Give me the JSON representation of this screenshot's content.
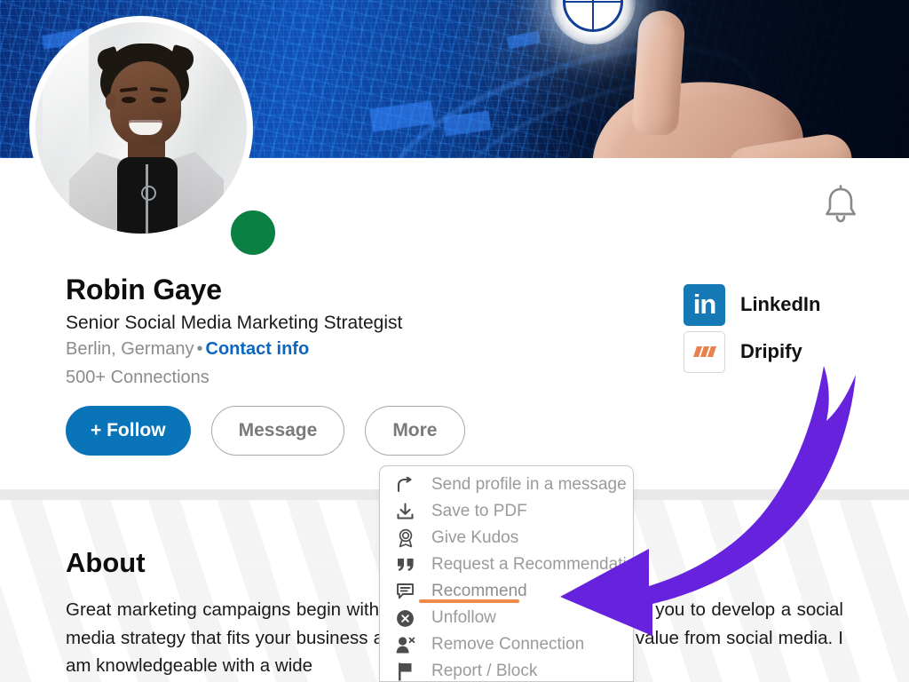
{
  "banner": {
    "alt": "blue city aerial banner with hand pressing glowing globe button"
  },
  "profile": {
    "name": "Robin Gaye",
    "headline": "Senior Social Media Marketing Strategist",
    "location": "Berlin, Germany",
    "separator": "•",
    "contact_info": "Contact info",
    "connections": "500+ Connections",
    "status": "online"
  },
  "actions": {
    "follow_label": "+ Follow",
    "message_label": "Message",
    "more_label": "More"
  },
  "badges": [
    {
      "label": "LinkedIn",
      "icon": "linkedin-icon",
      "glyph": "in"
    },
    {
      "label": "Dripify",
      "icon": "dripify-icon"
    }
  ],
  "notifications": {
    "icon": "bell-icon"
  },
  "more_menu": {
    "items": [
      {
        "label": "Send profile in a message",
        "icon": "share-arrow-icon",
        "highlighted": false
      },
      {
        "label": "Save to PDF",
        "icon": "download-icon",
        "highlighted": false
      },
      {
        "label": "Give Kudos",
        "icon": "award-ribbon-icon",
        "highlighted": false
      },
      {
        "label": "Request a Recommendation",
        "icon": "quote-icon",
        "highlighted": false
      },
      {
        "label": "Recommend",
        "icon": "speech-bubble-icon",
        "highlighted": true
      },
      {
        "label": "Unfollow",
        "icon": "x-circle-icon",
        "highlighted": false
      },
      {
        "label": "Remove Connection",
        "icon": "person-remove-icon",
        "highlighted": false
      },
      {
        "label": "Report / Block",
        "icon": "flag-icon",
        "highlighted": false
      }
    ]
  },
  "about": {
    "title": "About",
    "body": "Great marketing campaigns begin with a strong strategy. I will work with you to develop a social media strategy that fits your business and allows you to get maximum value from social media. I am knowledgeable with a wide"
  },
  "annotation": {
    "arrow_target": "Recommend",
    "arrow_color": "#6622dd",
    "highlight_color": "#f08a4b"
  },
  "colors": {
    "linkedin_blue": "#0a66c2",
    "follow_blue": "#0a74b9",
    "status_green": "#0b8043",
    "highlight_orange": "#f08a4b",
    "arrow_purple": "#6622dd",
    "band_gray": "#e9e9e9"
  }
}
